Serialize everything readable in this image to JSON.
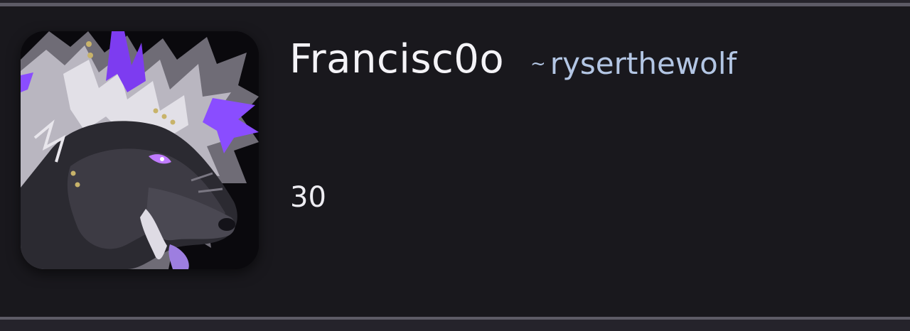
{
  "profile": {
    "display_name": "Francisc0o",
    "handle_prefix": "~",
    "handle": "ryserthewolf",
    "stat_value": "30",
    "avatar_icon": "wolf-avatar-icon"
  },
  "colors": {
    "background": "#19181d",
    "divider": "#5d5b66",
    "name_text": "#f4f3f7",
    "handle_text": "#b3c6e4",
    "avatar_accent": "#8a4dff"
  }
}
